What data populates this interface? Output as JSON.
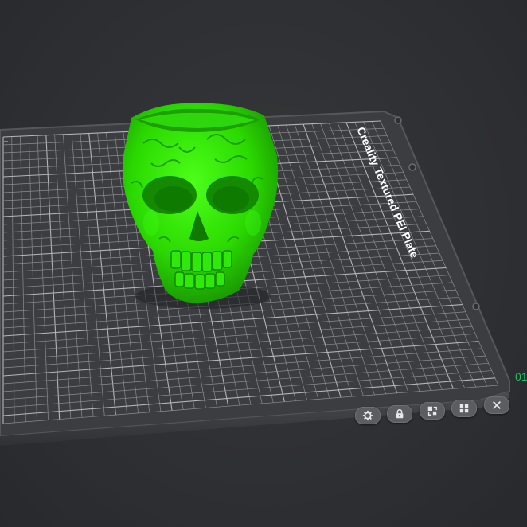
{
  "viewport": {
    "plate_label": "Creality Textured PEI Plate",
    "plate_index": "01",
    "model_color": "#2bd900",
    "accent_color": "#20c060",
    "background_color": "#2f3033",
    "plate_color": "#3d3e42",
    "grid_color": "#9a9b9e"
  },
  "plate_toolbar": {
    "buttons": [
      {
        "name": "plate-settings-button",
        "icon": "gear-icon"
      },
      {
        "name": "plate-lock-button",
        "icon": "lock-icon"
      },
      {
        "name": "plate-arrange-button",
        "icon": "arrange-icon"
      },
      {
        "name": "plate-layout-button",
        "icon": "grid-icon"
      },
      {
        "name": "plate-remove-button",
        "icon": "close-icon"
      }
    ]
  }
}
